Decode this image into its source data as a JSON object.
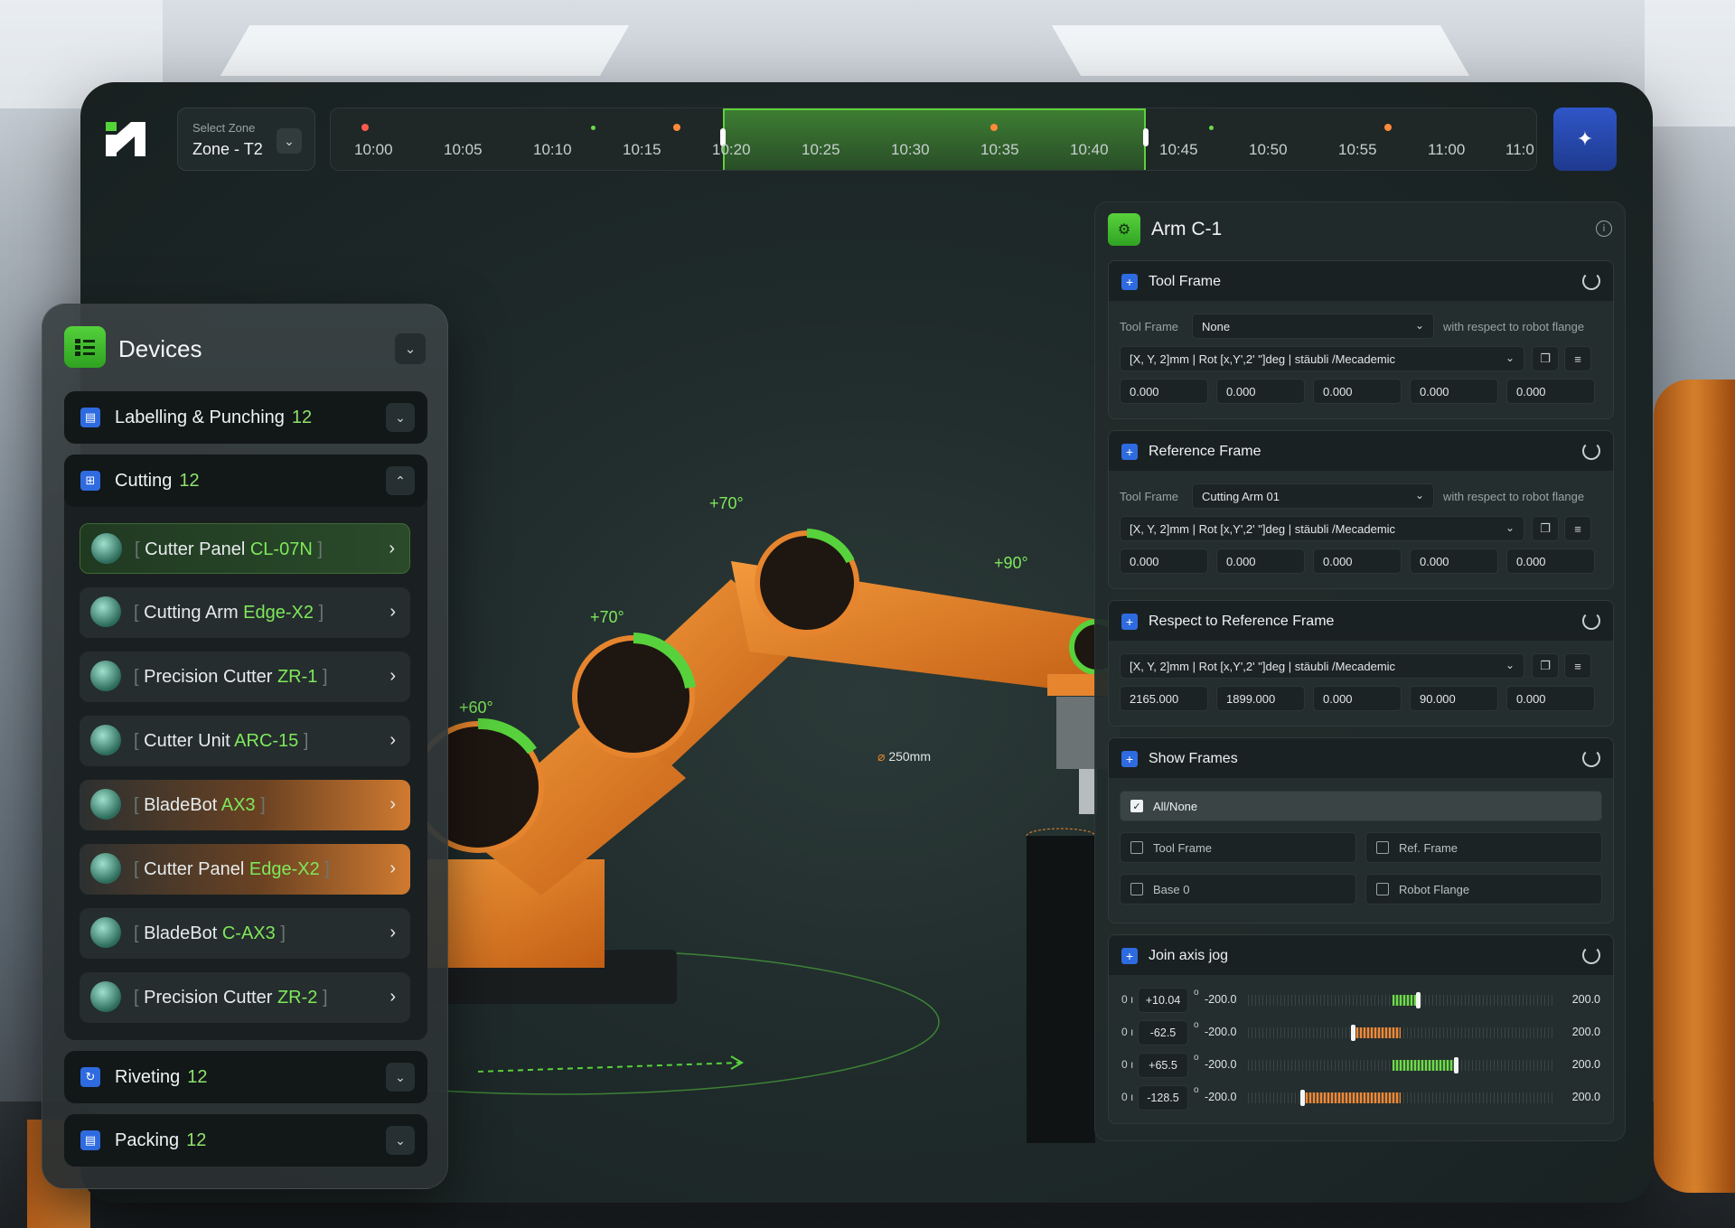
{
  "header": {
    "zone_label": "Select Zone",
    "zone_value": "Zone - T2",
    "timeline": [
      "10:00",
      "10:05",
      "10:10",
      "10:15",
      "10:20",
      "10:25",
      "10:30",
      "10:35",
      "10:40",
      "10:45",
      "10:50",
      "10:55",
      "11:00",
      "11:0"
    ],
    "ai_icon": "sparkle-icon"
  },
  "scene": {
    "joint_1": "+60°",
    "joint_2": "+70°",
    "joint_3": "+70°",
    "joint_4": "+90°",
    "diameter": "250mm"
  },
  "devices": {
    "title": "Devices",
    "categories": {
      "labelling": {
        "name": "Labelling & Punching",
        "count": "12"
      },
      "cutting": {
        "name": "Cutting",
        "count": "12"
      },
      "riveting": {
        "name": "Riveting",
        "count": "12"
      },
      "packing": {
        "name": "Packing",
        "count": "12"
      }
    },
    "items": [
      {
        "name": "Cutter Panel",
        "code": "CL-07N"
      },
      {
        "name": "Cutting Arm",
        "code": "Edge-X2"
      },
      {
        "name": "Precision Cutter",
        "code": "ZR-1"
      },
      {
        "name": "Cutter Unit",
        "code": "ARC-15"
      },
      {
        "name": "BladeBot",
        "code": "AX3"
      },
      {
        "name": "Cutter Panel",
        "code": "Edge-X2"
      },
      {
        "name": "BladeBot",
        "code": "C-AX3"
      },
      {
        "name": "Precision Cutter",
        "code": "ZR-2"
      }
    ],
    "bracket_open": "[",
    "bracket_close": "]"
  },
  "panel": {
    "title": "Arm  C-1",
    "tool_frame": {
      "title": "Tool Frame",
      "label": "Tool Frame",
      "select": "None",
      "note": "with respect to robot flange",
      "format": "[X, Y, 2]mm | Rot [x,Y',2' \"]deg | stäubli /Mecademic",
      "values": [
        "0.000",
        "0.000",
        "0.000",
        "0.000",
        "0.000"
      ]
    },
    "reference_frame": {
      "title": "Reference Frame",
      "label": "Tool Frame",
      "select": "Cutting Arm 01",
      "note": "with respect to robot flange",
      "format": "[X, Y, 2]mm | Rot [x,Y',2' \"]deg | stäubli /Mecademic",
      "values": [
        "0.000",
        "0.000",
        "0.000",
        "0.000",
        "0.000"
      ]
    },
    "respect_frame": {
      "title": "Respect to Reference Frame",
      "format": "[X, Y, 2]mm | Rot [x,Y',2' \"]deg | stäubli /Mecademic",
      "values": [
        "2165.000",
        "1899.000",
        "0.000",
        "90.000",
        "0.000"
      ]
    },
    "show_frames": {
      "title": "Show Frames",
      "all": "All/None",
      "options": [
        "Tool Frame",
        "Ref. Frame",
        "Base 0",
        "Robot Flange"
      ]
    },
    "jog": {
      "title": "Join axis jog",
      "rows": [
        {
          "axis": "0 ı",
          "value": "+10.04",
          "deg": "o",
          "min": "-200.0",
          "max": "200.0"
        },
        {
          "axis": "0 ı",
          "value": "-62.5",
          "deg": "o",
          "min": "-200.0",
          "max": "200.0"
        },
        {
          "axis": "0 ı",
          "value": "+65.5",
          "deg": "o",
          "min": "-200.0",
          "max": "200.0"
        },
        {
          "axis": "0 ı",
          "value": "-128.5",
          "deg": "o",
          "min": "-200.0",
          "max": "200.0"
        }
      ]
    }
  }
}
